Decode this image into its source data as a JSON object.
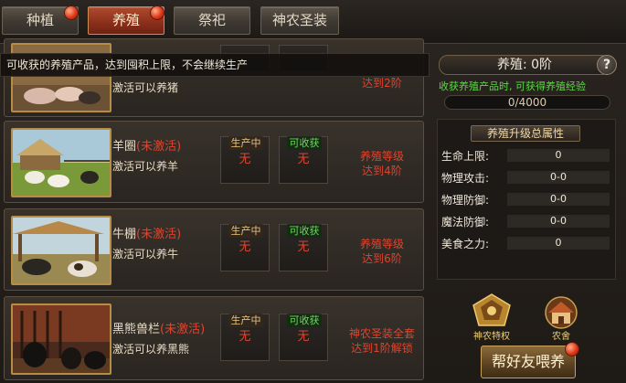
{
  "tabs": [
    {
      "label": "种植"
    },
    {
      "label": "养殖"
    },
    {
      "label": "祭祀"
    },
    {
      "label": "神农圣装"
    }
  ],
  "notice": "可收获的养殖产品，达到囤积上限，不会继续生产",
  "rows": [
    {
      "name": "",
      "state": "",
      "desc": "激活可以养猪",
      "prod_label": "",
      "harv_label": "",
      "prod_value": "",
      "harv_value": "",
      "req_line1": "",
      "req_line2": "达到2阶"
    },
    {
      "name": "羊圈",
      "state": "(未激活)",
      "desc": "激活可以养羊",
      "prod_label": "生产中",
      "harv_label": "可收获",
      "prod_value": "无",
      "harv_value": "无",
      "req_line1": "养殖等级",
      "req_line2": "达到4阶"
    },
    {
      "name": "牛棚",
      "state": "(未激活)",
      "desc": "激活可以养牛",
      "prod_label": "生产中",
      "harv_label": "可收获",
      "prod_value": "无",
      "harv_value": "无",
      "req_line1": "养殖等级",
      "req_line2": "达到6阶"
    },
    {
      "name": "黑熊兽栏",
      "state": "(未激活)",
      "desc": "激活可以养黑熊",
      "prod_label": "生产中",
      "harv_label": "可收获",
      "prod_value": "无",
      "harv_value": "无",
      "req_line1": "神农圣装全套",
      "req_line2": "达到1阶解锁"
    }
  ],
  "panel": {
    "rank": "养殖: 0阶",
    "help": "?",
    "hint": "收获养殖产品时, 可获得养殖经验",
    "exp": "0/4000",
    "attr_title": "养殖升级总属性",
    "attrs": [
      {
        "k": "生命上限:",
        "v": "0"
      },
      {
        "k": "物理攻击:",
        "v": "0-0"
      },
      {
        "k": "物理防御:",
        "v": "0-0"
      },
      {
        "k": "魔法防御:",
        "v": "0-0"
      },
      {
        "k": "美食之力:",
        "v": "0"
      }
    ],
    "icon1": "神农特权",
    "icon2": "农舍",
    "feed_button": "帮好友喂养"
  },
  "colors": {
    "accent_red": "#e0432e",
    "green": "#5fd84a",
    "gold": "#b98c45"
  }
}
